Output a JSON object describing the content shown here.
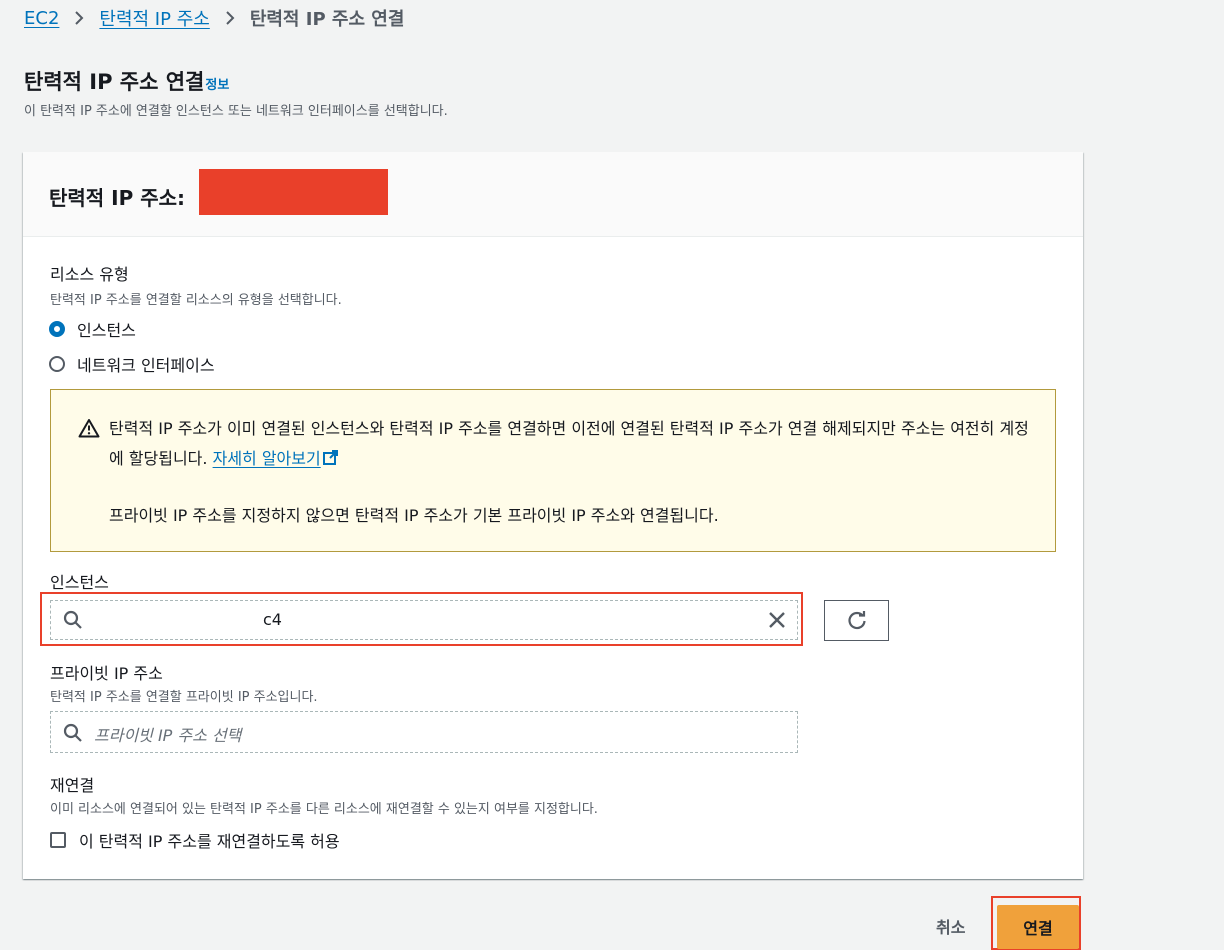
{
  "breadcrumb": {
    "root": "EC2",
    "parent": "탄력적 IP 주소",
    "current": "탄력적 IP 주소 연결"
  },
  "page": {
    "title": "탄력적 IP 주소 연결",
    "info": "정보",
    "description": "이 탄력적 IP 주소에 연결할 인스턴스 또는 네트워크 인터페이스를 선택합니다."
  },
  "panel": {
    "title": "탄력적 IP 주소:"
  },
  "resource_type": {
    "label": "리소스 유형",
    "description": "탄력적 IP 주소를 연결할 리소스의 유형을 선택합니다.",
    "options": [
      "인스턴스",
      "네트워크 인터페이스"
    ],
    "selected": "인스턴스"
  },
  "alert": {
    "text": "탄력적 IP 주소가 이미 연결된 인스턴스와 탄력적 IP 주소를 연결하면 이전에 연결된 탄력적 IP 주소가 연결 해제되지만 주소는 여전히 계정에 할당됩니다.",
    "link": "자세히 알아보기",
    "text2": "프라이빗 IP 주소를 지정하지 않으면 탄력적 IP 주소가 기본 프라이빗 IP 주소와 연결됩니다."
  },
  "instance": {
    "label": "인스턴스",
    "value": "c4"
  },
  "private_ip": {
    "label": "프라이빗 IP 주소",
    "description": "탄력적 IP 주소를 연결할 프라이빗 IP 주소입니다.",
    "placeholder": "프라이빗 IP 주소 선택"
  },
  "reassociation": {
    "label": "재연결",
    "description": "이미 리소스에 연결되어 있는 탄력적 IP 주소를 다른 리소스에 재연결할 수 있는지 여부를 지정합니다.",
    "checkbox_label": "이 탄력적 IP 주소를 재연결하도록 허용",
    "checked": false
  },
  "actions": {
    "cancel": "취소",
    "connect": "연결"
  },
  "colors": {
    "link": "#0073bb",
    "primary_button": "#f0a13b",
    "highlight": "#e9402a",
    "alert_bg": "#fffce9"
  }
}
